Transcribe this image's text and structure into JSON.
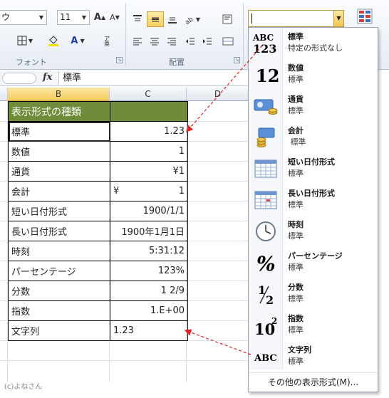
{
  "ribbon": {
    "font_label": "フォント",
    "align_label": "配置",
    "font_family_partial": "ウ",
    "font_size": "11",
    "grow_font": "A",
    "shrink_font": "A",
    "font_color_glyph": "A"
  },
  "formula_bar": {
    "fx": "fx",
    "content": "標準"
  },
  "sheet": {
    "columns": [
      "B",
      "C",
      "D"
    ],
    "header": "表示形式の種類",
    "rows": [
      {
        "b": "標準",
        "c": "1.23"
      },
      {
        "b": "数値",
        "c": "1"
      },
      {
        "b": "通貨",
        "c": "¥1"
      },
      {
        "b": "会計",
        "c_sym": "¥",
        "c": "1"
      },
      {
        "b": "短い日付形式",
        "c": "1900/1/1"
      },
      {
        "b": "長い日付形式",
        "c": "1900年1月1日"
      },
      {
        "b": "時刻",
        "c": "5:31:12"
      },
      {
        "b": "パーセンテージ",
        "c": "123%"
      },
      {
        "b": "分数",
        "c": "1 2/9"
      },
      {
        "b": "指数",
        "c": "1.E+00"
      },
      {
        "b": "文字列",
        "c": "1.23"
      }
    ],
    "watermark": "(c)よねさん"
  },
  "number_format_menu": {
    "items": [
      {
        "name": "標準",
        "preview": "特定の形式なし",
        "icon": "abc-123-icon"
      },
      {
        "name": "数値",
        "preview": "標準",
        "icon": "number-12-icon"
      },
      {
        "name": "通貨",
        "preview": "標準",
        "icon": "currency-icon"
      },
      {
        "name": "会計",
        "preview": " 標準",
        "icon": "accounting-icon"
      },
      {
        "name": "短い日付形式",
        "preview": "標準",
        "icon": "short-date-calendar-icon"
      },
      {
        "name": "長い日付形式",
        "preview": "標準",
        "icon": "long-date-calendar-icon"
      },
      {
        "name": "時刻",
        "preview": "標準",
        "icon": "clock-icon"
      },
      {
        "name": "パーセンテージ",
        "preview": "標準",
        "icon": "percent-icon"
      },
      {
        "name": "分数",
        "preview": "標準",
        "icon": "fraction-icon"
      },
      {
        "name": "指数",
        "preview": "標準",
        "icon": "exponent-icon"
      },
      {
        "name": "文字列",
        "preview": "標準",
        "icon": "abc-text-icon"
      }
    ],
    "icon_text": {
      "abc": "ABC",
      "n123": "123",
      "twelve": "12",
      "percent": "%",
      "half_top": "1",
      "half_bottom": "2",
      "ten": "10",
      "sup2": "2",
      "abc2": "ABC"
    },
    "more": "その他の表示形式(M)..."
  },
  "colors": {
    "header_fill": "#6f8c3a",
    "arrow": "#e02020",
    "selected_tool": "#f8cf63"
  }
}
